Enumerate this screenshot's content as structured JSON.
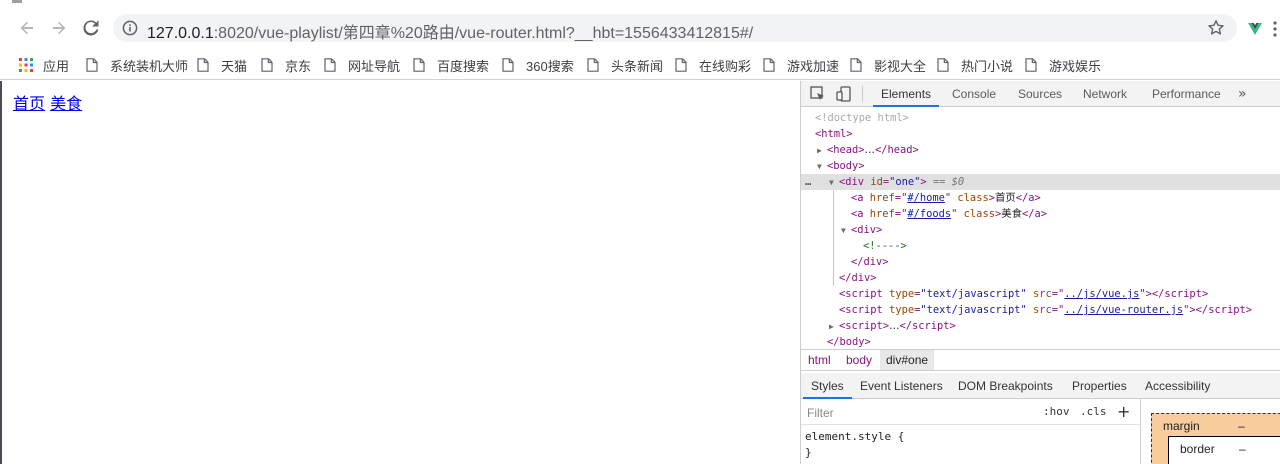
{
  "browser": {
    "url_host": "127.0.0.1",
    "url_rest": ":8020/vue-playlist/第四章%20路由/vue-router.html?__hbt=1556433412815#/",
    "icons": [
      "back-arrow-icon",
      "forward-arrow-icon",
      "reload-icon",
      "info-icon",
      "star-icon",
      "vue-devtools-icon",
      "menu-dots-icon"
    ]
  },
  "bookmarks": [
    {
      "label": "应用",
      "icon": "apps-grid-icon"
    },
    {
      "label": "系统装机大师",
      "icon": "page-icon"
    },
    {
      "label": "天猫",
      "icon": "page-icon"
    },
    {
      "label": "京东",
      "icon": "page-icon"
    },
    {
      "label": "网址导航",
      "icon": "page-icon"
    },
    {
      "label": "百度搜索",
      "icon": "page-icon"
    },
    {
      "label": "360搜索",
      "icon": "page-icon"
    },
    {
      "label": "头条新闻",
      "icon": "page-icon"
    },
    {
      "label": "在线购彩",
      "icon": "page-icon"
    },
    {
      "label": "游戏加速",
      "icon": "page-icon"
    },
    {
      "label": "影视大全",
      "icon": "page-icon"
    },
    {
      "label": "热门小说",
      "icon": "page-icon"
    },
    {
      "label": "游戏娱乐",
      "icon": "page-icon"
    }
  ],
  "page": {
    "links": [
      "首页",
      "美食"
    ]
  },
  "devtools": {
    "tabs": [
      "Elements",
      "Console",
      "Sources",
      "Network",
      "Performance"
    ],
    "active_tab": "Elements",
    "more": "»",
    "tree": {
      "doctype": "<!doctype html>",
      "html_open": "<html>",
      "head_open": "<head>",
      "head_ellipsis": "…",
      "head_close": "</head>",
      "body_open": "<body>",
      "div_tag": "div",
      "div_attr": "id",
      "div_id": "\"one\"",
      "selected_marker": "== $0",
      "a_tag": "a",
      "href_attr": "href",
      "class_attr": "class",
      "a1_href": "#/home",
      "a1_text": "首页",
      "a2_href": "#/foods",
      "a2_text": "美食",
      "inner_div_open": "<div>",
      "comment": "<!---->",
      "inner_div_close": "</div>",
      "div_close": "</div>",
      "script_tag": "script",
      "type_attr": "type",
      "src_attr": "src",
      "script_type": "\"text/javascript\"",
      "script1_src": "../js/vue.js",
      "script2_src": "../js/vue-router.js",
      "script3_ellipsis": "…",
      "body_close": "</body>"
    },
    "breadcrumbs": [
      "html",
      "body",
      "div#one"
    ],
    "sub_tabs": [
      "Styles",
      "Event Listeners",
      "DOM Breakpoints",
      "Properties",
      "Accessibility"
    ],
    "active_sub_tab": "Styles",
    "filter_placeholder": "Filter",
    "hov_label": ":hov",
    "cls_label": ".cls",
    "plus_label": "+",
    "style_rule_open": "element.style {",
    "style_rule_close": "}",
    "box_model": {
      "margin_label": "margin",
      "margin_value": "–",
      "border_label": "border",
      "border_value": "–"
    }
  },
  "colors": {
    "link": "#0000ee",
    "tag": "#881280",
    "attr": "#994500",
    "value": "#1a1aa6",
    "active_tab_underline": "#1a73e8",
    "margin_box": "#f9cc9d"
  }
}
